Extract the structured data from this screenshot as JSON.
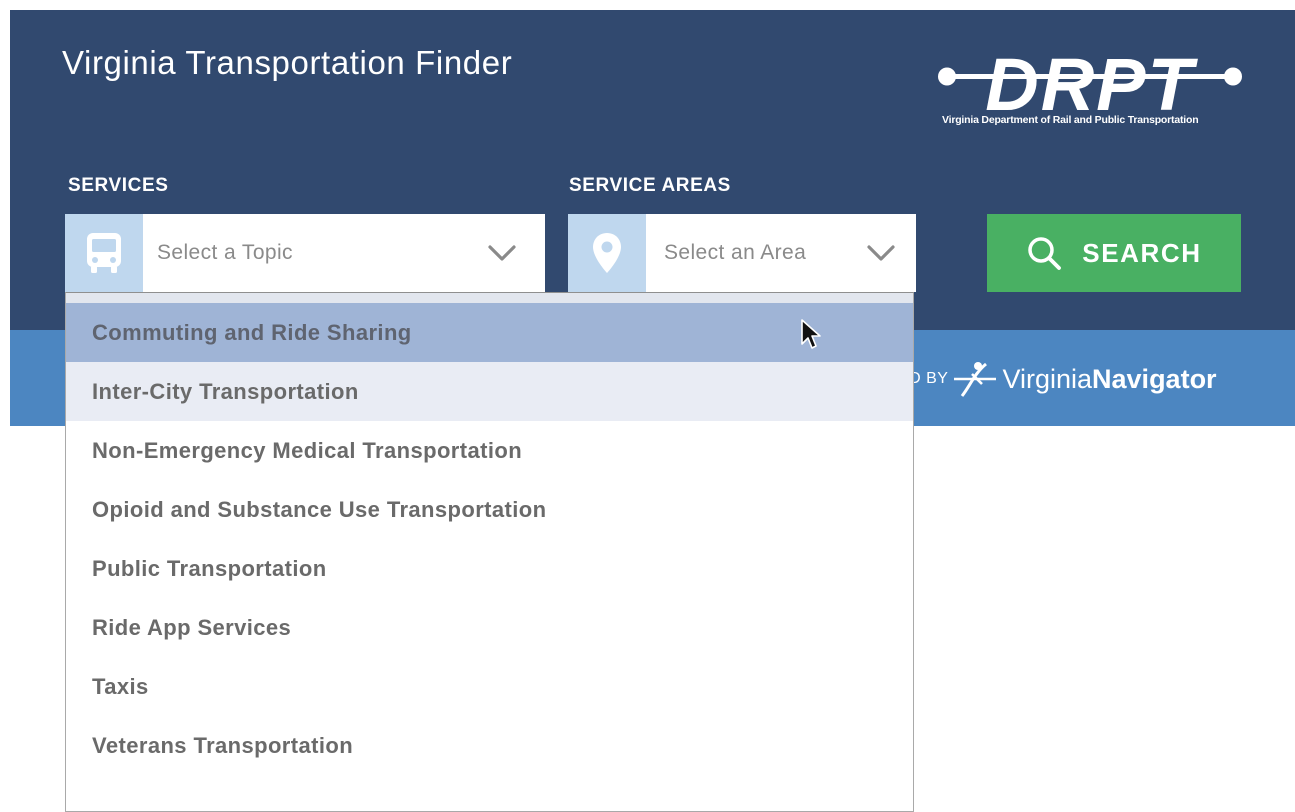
{
  "header": {
    "title": "Virginia Transportation Finder",
    "logo_text": "DRPT",
    "logo_subtitle": "Virginia Department of Rail and Public Transportation"
  },
  "services": {
    "label": "SERVICES",
    "placeholder": "Select a Topic",
    "icon": "bus-icon"
  },
  "service_areas": {
    "label": "SERVICE AREAS",
    "placeholder": "Select an Area",
    "icon": "map-pin-icon"
  },
  "search": {
    "label": "SEARCH",
    "icon": "search-icon"
  },
  "powered_by": {
    "prefix": "POWERED BY",
    "brand_regular": "Virginia",
    "brand_bold": "Navigator"
  },
  "dropdown": {
    "options": [
      "Commuting and Ride Sharing",
      "Inter-City Transportation",
      "Non-Emergency Medical Transportation",
      "Opioid and Substance Use Transportation",
      "Public Transportation",
      "Ride App Services",
      "Taxis",
      "Veterans Transportation"
    ],
    "hovered_index": 0
  },
  "colors": {
    "header_bg": "#31496f",
    "band_bg": "#4c86c1",
    "search_green": "#49b063",
    "icon_bg": "#bfd7ee",
    "hover_bg": "#9fb4d6"
  }
}
